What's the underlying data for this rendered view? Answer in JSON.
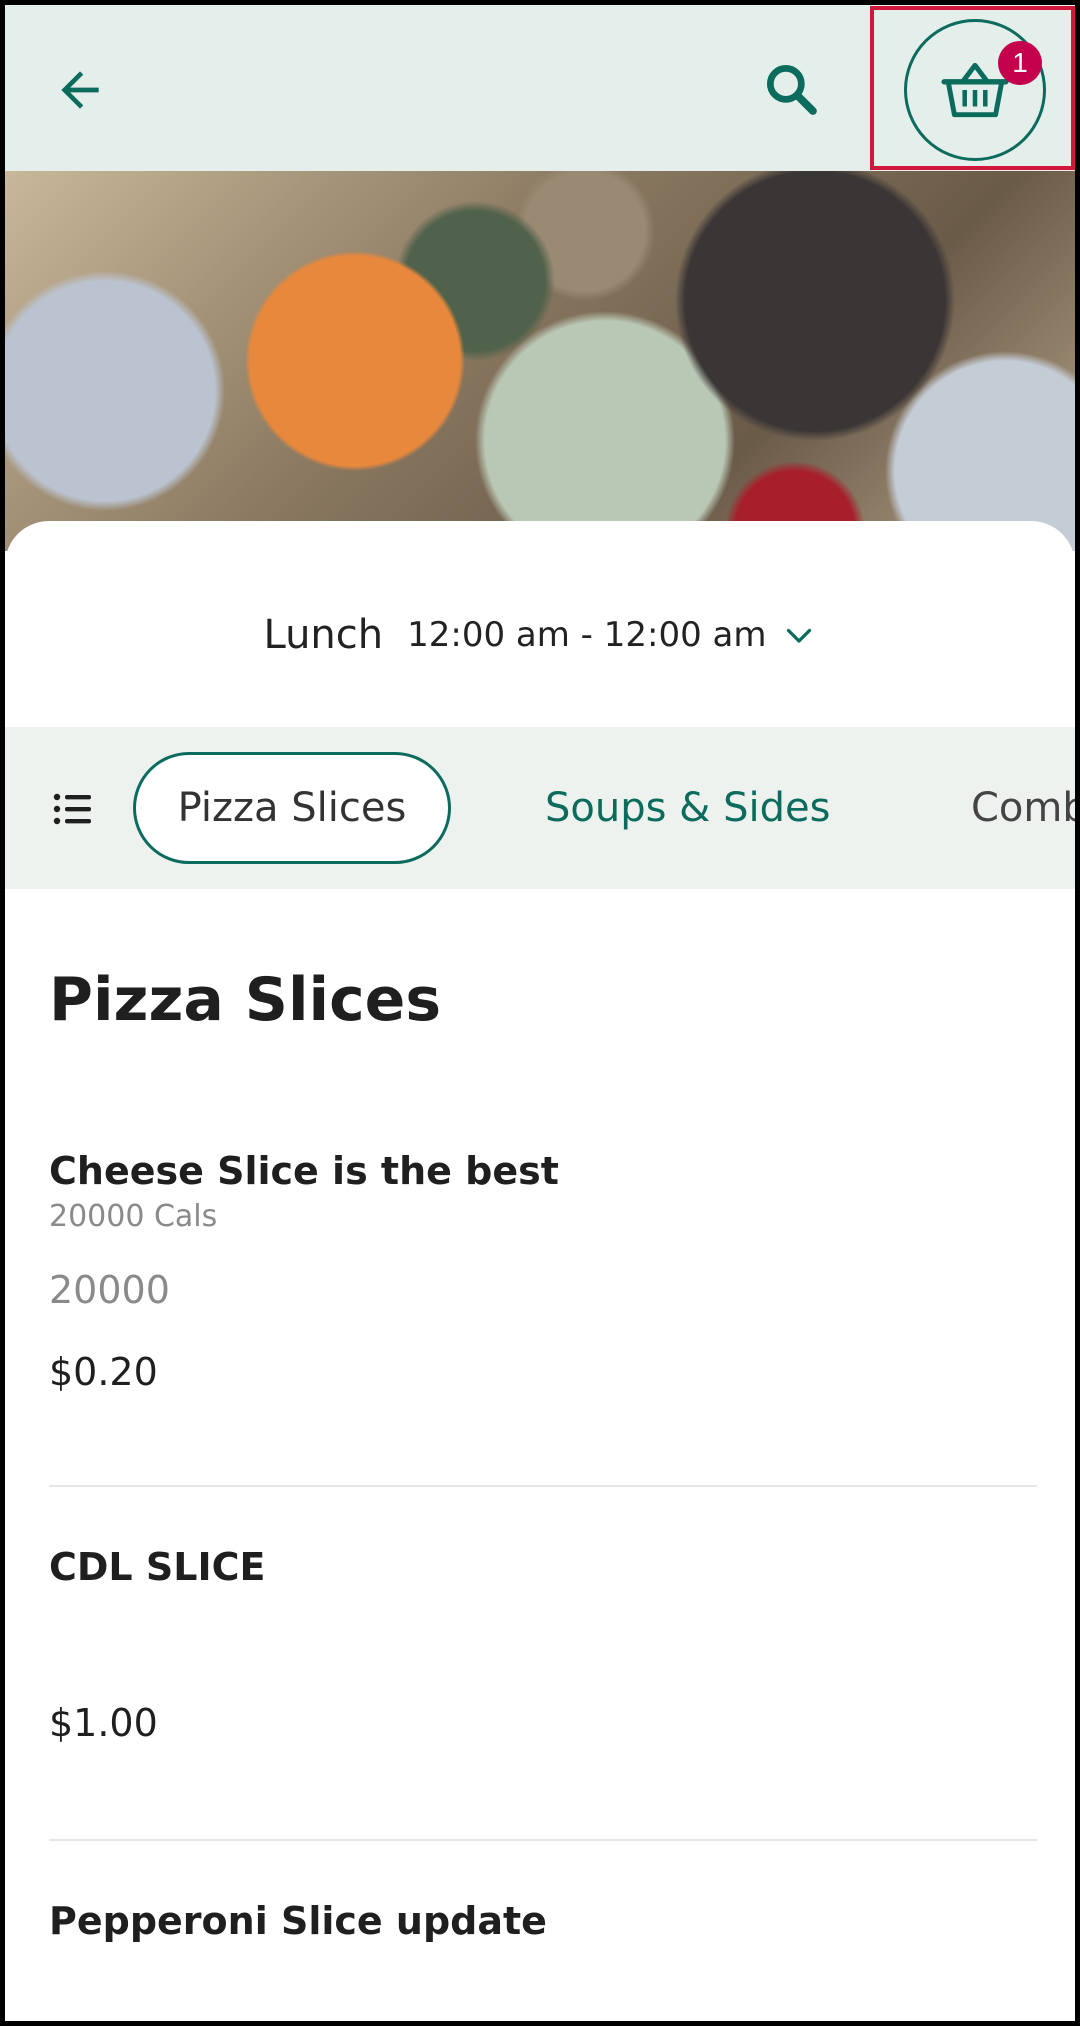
{
  "topbar": {
    "cart_count": "1",
    "icons": [
      "back-arrow-icon",
      "search-icon",
      "basket-icon"
    ],
    "accent_color": "#0b6b5d",
    "badge_color": "#c4004d"
  },
  "meal": {
    "name": "Lunch",
    "time": "12:00 am - 12:00 am"
  },
  "categories": [
    "Pizza Slices",
    "Soups & Sides",
    "Comb"
  ],
  "section": {
    "title": "Pizza Slices"
  },
  "items": [
    {
      "name": "Cheese Slice is the best",
      "calories": "20000 Cals",
      "description": "20000",
      "price": "$0.20"
    },
    {
      "name": "CDL SLICE",
      "price": "$1.00"
    },
    {
      "name": "Pepperoni Slice update"
    }
  ]
}
